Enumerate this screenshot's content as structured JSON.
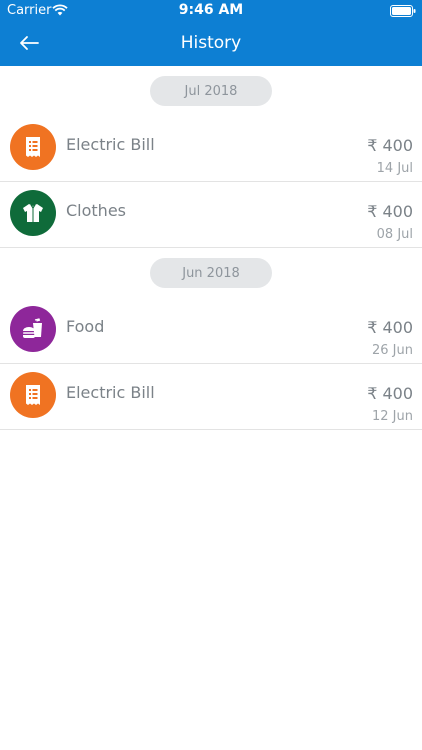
{
  "status_bar": {
    "carrier": "Carrier",
    "time": "9:46 AM"
  },
  "nav": {
    "title": "History",
    "back_icon": "back-arrow-icon"
  },
  "sections": [
    {
      "label": "Jul 2018",
      "items": [
        {
          "label": "Electric Bill",
          "amount": "₹ 400",
          "date": "14 Jul",
          "icon": "bill-icon",
          "color": "#f07322"
        },
        {
          "label": "Clothes",
          "amount": "₹ 400",
          "date": "08 Jul",
          "icon": "shirt-icon",
          "color": "#0f6b3a"
        }
      ]
    },
    {
      "label": "Jun 2018",
      "items": [
        {
          "label": "Food",
          "amount": "₹ 400",
          "date": "26 Jun",
          "icon": "food-icon",
          "color": "#8e279a"
        },
        {
          "label": "Electric Bill",
          "amount": "₹ 400",
          "date": "12 Jun",
          "icon": "bill-icon",
          "color": "#f07322"
        }
      ]
    }
  ],
  "colors": {
    "header": "#0d7fd3",
    "pill_bg": "#e4e6e8"
  }
}
